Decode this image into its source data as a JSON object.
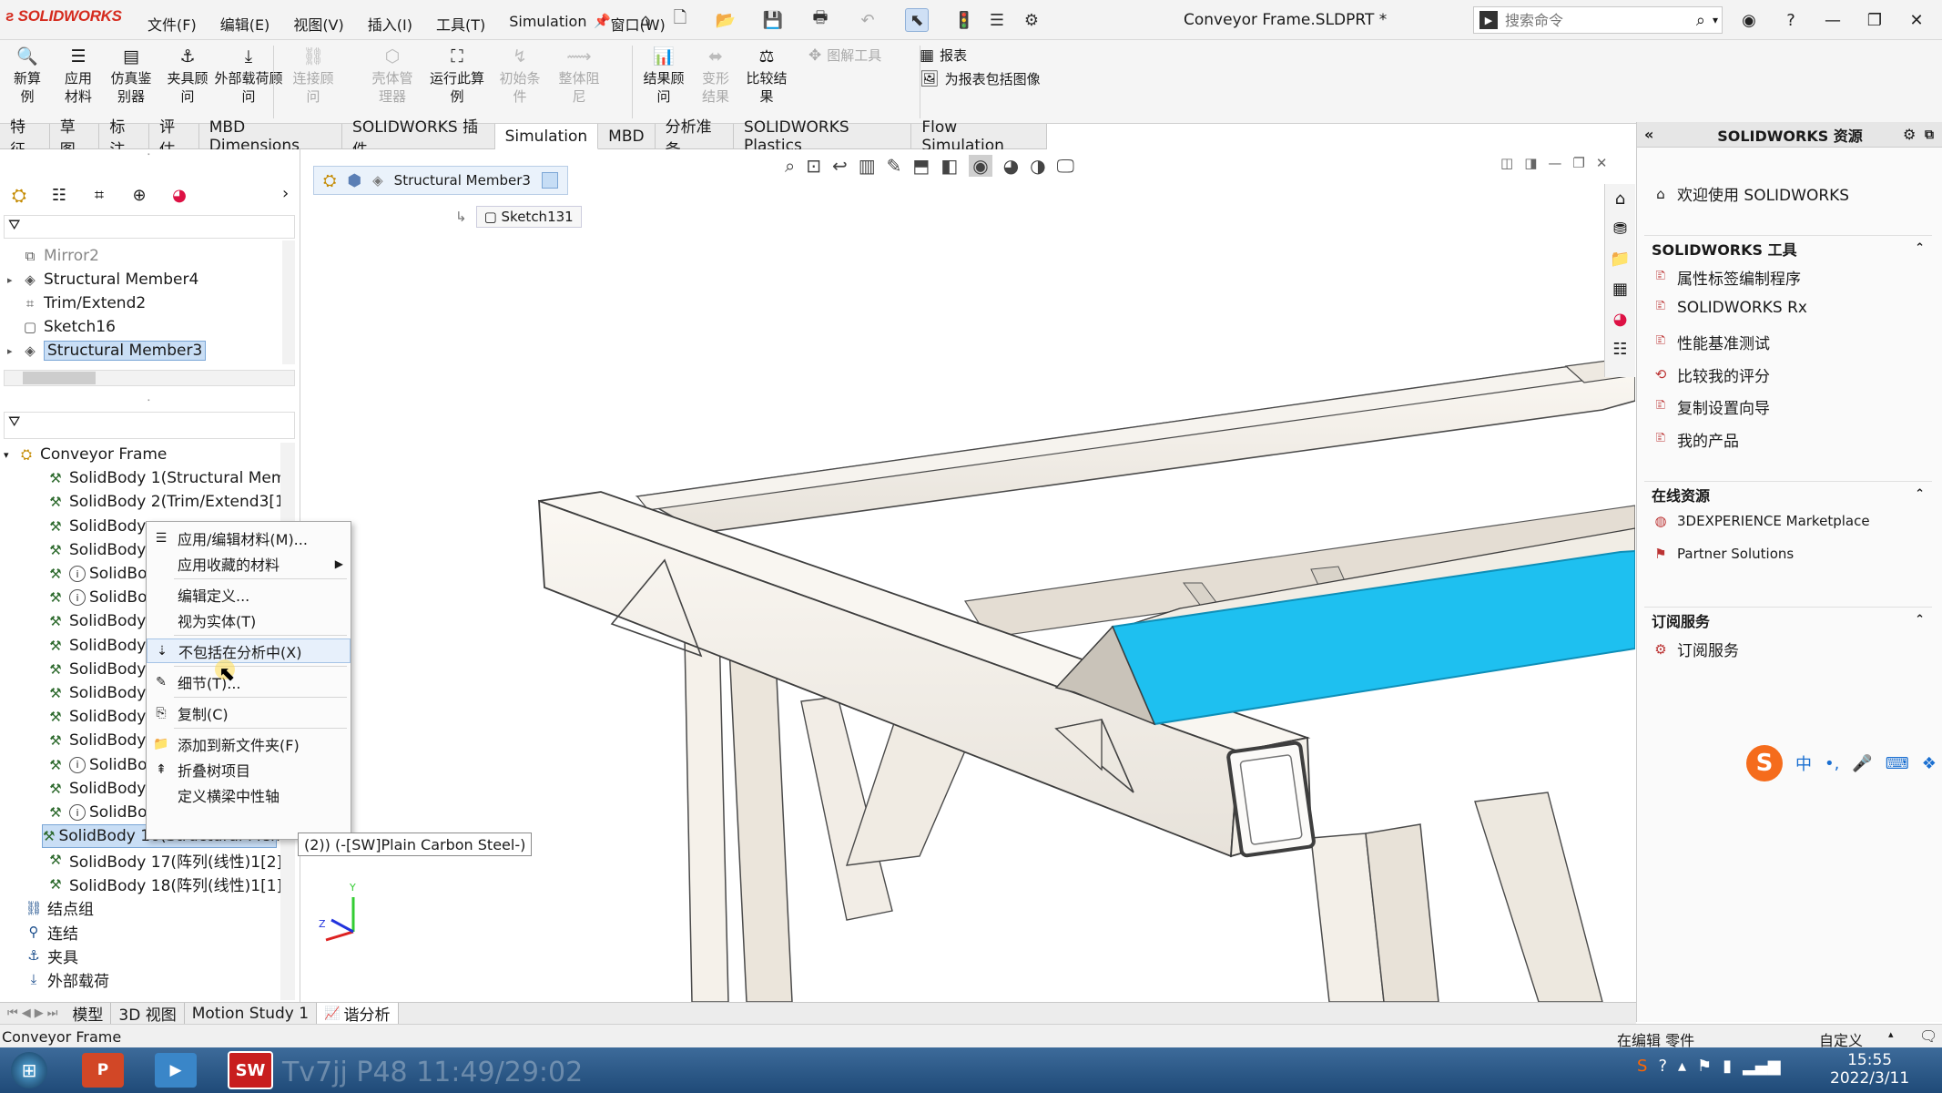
{
  "app": {
    "logo_text": "SOLIDWORKS",
    "document_title": "Conveyor Frame.SLDPRT *"
  },
  "menubar": [
    "文件(F)",
    "编辑(E)",
    "视图(V)",
    "插入(I)",
    "工具(T)",
    "Simulation",
    "窗口(W)"
  ],
  "search": {
    "placeholder": "搜索命令"
  },
  "ribbon": {
    "buttons": [
      {
        "label": "新算例",
        "icon": "study-icon",
        "enabled": true
      },
      {
        "label": "应用材料",
        "icon": "material-icon",
        "enabled": true
      },
      {
        "label": "仿真鉴别器",
        "icon": "simulation-evaluator-icon",
        "enabled": true
      },
      {
        "label": "夹具顾问",
        "icon": "fixture-icon",
        "enabled": true
      },
      {
        "label": "外部载荷顾问",
        "icon": "load-icon",
        "enabled": true
      },
      {
        "label": "连接顾问",
        "icon": "connection-icon",
        "enabled": false
      },
      {
        "label": "壳体管理器",
        "icon": "shell-icon",
        "enabled": false
      },
      {
        "label": "运行此算例",
        "icon": "run-icon",
        "enabled": true
      },
      {
        "label": "初始条件",
        "icon": "initial-condition-icon",
        "enabled": false
      },
      {
        "label": "整体阻尼",
        "icon": "damping-icon",
        "enabled": false
      },
      {
        "label": "结果顾问",
        "icon": "result-icon",
        "enabled": true
      },
      {
        "label": "变形结果",
        "icon": "deformed-icon",
        "enabled": false
      },
      {
        "label": "比较结果",
        "icon": "compare-icon",
        "enabled": true
      }
    ],
    "side_items": [
      {
        "label": "图解工具",
        "icon": "plot-tools-icon",
        "enabled": false
      },
      {
        "label": "报表",
        "icon": "report-icon",
        "enabled": true
      },
      {
        "label": "为报表包括图像",
        "icon": "include-image-icon",
        "enabled": true
      }
    ]
  },
  "command_tabs": [
    "特征",
    "草图",
    "标注",
    "评估",
    "MBD Dimensions",
    "SOLIDWORKS 插件",
    "Simulation",
    "MBD",
    "分析准备",
    "SOLIDWORKS Plastics",
    "Flow Simulation"
  ],
  "active_command_tab": "Simulation",
  "feature_tree": [
    {
      "label": "Mirror2",
      "icon": "mirror-icon",
      "dim": true
    },
    {
      "label": "Structural Member4",
      "icon": "structural-member-icon",
      "expand": true
    },
    {
      "label": "Trim/Extend2",
      "icon": "trim-icon"
    },
    {
      "label": "Sketch16",
      "icon": "sketch-icon"
    },
    {
      "label": "Structural Member3",
      "icon": "structural-member-icon",
      "expand": true,
      "selected": true
    }
  ],
  "study_tree": {
    "root": "Conveyor Frame",
    "bodies": [
      "SolidBody 1(Structural Membe",
      "SolidBody 2(Trim/Extend3[1]) (",
      "SolidBody",
      "SolidBody",
      "SolidBo",
      "SolidBo",
      "SolidBody",
      "SolidBody",
      "SolidBody",
      "SolidBody",
      "SolidBody",
      "SolidBody",
      "SolidBo",
      "SolidBody",
      "SolidBo",
      "SolidBody 16(Structural Memb",
      "SolidBody 17(阵列(线性)1[2])",
      "SolidBody 18(阵列(线性)1[1])"
    ],
    "info_rows": [
      4,
      5,
      12,
      14
    ],
    "selected_row": 15,
    "groups": [
      "结点组",
      "连结",
      "夹具",
      "外部载荷"
    ]
  },
  "context_menu": {
    "items": [
      {
        "label": "应用/编辑材料(M)...",
        "icon": "material-list-icon"
      },
      {
        "label": "应用收藏的材料",
        "submenu": true
      },
      {
        "label": "编辑定义...",
        "sep_before": true
      },
      {
        "label": "视为实体(T)"
      },
      {
        "label": "不包括在分析中(X)",
        "icon": "exclude-icon",
        "sep_before": true,
        "highlight": true
      },
      {
        "label": "细节(T)...",
        "icon": "details-icon",
        "sep_before": true
      },
      {
        "label": "复制(C)",
        "icon": "copy-icon",
        "sep_before": true
      },
      {
        "label": "添加到新文件夹(F)",
        "icon": "folder-icon",
        "sep_before": true
      },
      {
        "label": "折叠树项目",
        "icon": "collapse-icon"
      },
      {
        "label": "定义横梁中性轴"
      }
    ]
  },
  "tooltip": "(2)) (-[SW]Plain Carbon Steel-)",
  "viewport": {
    "breadcrumb": [
      "Structural Member3",
      "Sketch131"
    ]
  },
  "resources": {
    "title": "SOLIDWORKS 资源",
    "welcome": "欢迎使用 SOLIDWORKS",
    "sections": [
      {
        "title": "SOLIDWORKS 工具",
        "items": [
          "属性标签编制程序",
          "SOLIDWORKS Rx",
          "性能基准测试",
          "比较我的评分",
          "复制设置向导",
          "我的产品"
        ]
      },
      {
        "title": "在线资源",
        "items": [
          "3DEXPERIENCE Marketplace",
          "Partner Solutions"
        ]
      },
      {
        "title": "订阅服务",
        "items": [
          "订阅服务"
        ]
      }
    ]
  },
  "bottom_tabs": [
    "模型",
    "3D 视图",
    "Motion Study 1",
    "谐分析"
  ],
  "active_bottom_tab": "谐分析",
  "status": {
    "left": "Conveyor Frame",
    "mode": "在编辑 零件",
    "custom": "自定义"
  },
  "taskbar": {
    "time": "15:55",
    "date": "2022/3/11",
    "overlay_text": "Tv7jj P48 11:49/29:02"
  },
  "colors": {
    "selected_beam": "#1ec0f0",
    "brand_red": "#d52b1e",
    "selection_bg": "#c9def5"
  }
}
